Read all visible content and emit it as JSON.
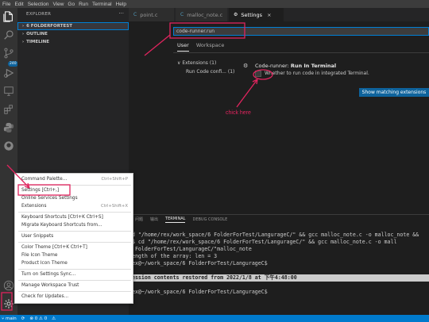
{
  "menubar": [
    "File",
    "Edit",
    "Selection",
    "View",
    "Go",
    "Run",
    "Terminal",
    "Help"
  ],
  "activity_icons": [
    "explorer-icon",
    "search-icon",
    "source-control-icon",
    "run-debug-icon",
    "remote-explorer-icon",
    "extensions-icon",
    "python-icon",
    "github-icon",
    "account-icon",
    "manage-gear-icon"
  ],
  "activity_badge": "240",
  "sidebar": {
    "title": "EXPLORER",
    "more": "···",
    "sections": [
      {
        "label": "6 FOLDERFORTEST",
        "active": true
      },
      {
        "label": "OUTLINE",
        "active": false
      },
      {
        "label": "TIMELINE",
        "active": false
      }
    ]
  },
  "tabs": [
    {
      "label": "point.c",
      "icon": "C",
      "active": false
    },
    {
      "label": "malloc_note.c",
      "icon": "C",
      "active": false
    },
    {
      "label": "Settings",
      "icon": "⚙",
      "active": true,
      "close": "×"
    }
  ],
  "settings": {
    "search_value": "code-runner.run",
    "scopes": [
      {
        "label": "User",
        "active": true
      },
      {
        "label": "Workspace",
        "active": false
      }
    ],
    "toc": [
      {
        "label": "Extensions (1)",
        "chev": "∨"
      },
      {
        "label": "Run Code confi... (1)",
        "chev": ""
      }
    ],
    "setting_prefix": "Code-runner: ",
    "setting_name": "Run In Terminal",
    "setting_desc": "Whether to run code in integrated Terminal.",
    "match_button": "Show matching extensions"
  },
  "annotation": {
    "text": "chick here",
    "color": "#e0245e"
  },
  "panel": {
    "tabs": [
      {
        "label": "问题",
        "active": false
      },
      {
        "label": "输出",
        "active": false
      },
      {
        "label": "TERMINAL",
        "active": true
      },
      {
        "label": "DEBUG CONSOLE",
        "active": false
      }
    ],
    "terminal_lines": [
      {
        "text": "cd \"/home/rex/work_space/6 FolderForTest/LangurageC/\" && gcc malloc_note.c -o malloc_note &&",
        "hl": false
      },
      {
        "text": "r$ cd \"/home/rex/work_space/6 FolderForTest/LangurageC/\" && gcc malloc_note.c -o mall",
        "hl": false
      },
      {
        "text": "6 FolderForTest/LangurageC/\"malloc_note",
        "hl": false
      },
      {
        "text": "length of the array: len = 3",
        "hl": false
      },
      {
        "text": "rex@~/work_space/6 FolderForTest/LangurageC$",
        "hl": false
      },
      {
        "text": "",
        "hl": false
      },
      {
        "text": "Session contents restored from 2022/1/8 at 下午4:48:00",
        "hl": true
      },
      {
        "text": "",
        "hl": false
      },
      {
        "text": "rex@~/work_space/6 FolderForTest/LangurageC$",
        "hl": false
      }
    ]
  },
  "context_menu": [
    {
      "label": "Command Palette...",
      "shortcut": "Ctrl+Shift+P",
      "sep_after": true
    },
    {
      "label": "Settings [Ctrl+,]",
      "shortcut": "",
      "sep_after": false
    },
    {
      "label": "Online Services Settings",
      "shortcut": "",
      "sep_after": false
    },
    {
      "label": "Extensions",
      "shortcut": "Ctrl+Shift+X",
      "sep_after": true
    },
    {
      "label": "Keyboard Shortcuts [Ctrl+K Ctrl+S]",
      "shortcut": "",
      "sep_after": false
    },
    {
      "label": "Migrate Keyboard Shortcuts from...",
      "shortcut": "",
      "sep_after": true
    },
    {
      "label": "User Snippets",
      "shortcut": "",
      "sep_after": true
    },
    {
      "label": "Color Theme [Ctrl+K Ctrl+T]",
      "shortcut": "",
      "sep_after": false
    },
    {
      "label": "File Icon Theme",
      "shortcut": "",
      "sep_after": false
    },
    {
      "label": "Product Icon Theme",
      "shortcut": "",
      "sep_after": true
    },
    {
      "label": "Turn on Settings Sync...",
      "shortcut": "",
      "sep_after": true
    },
    {
      "label": "Manage Workspace Trust",
      "shortcut": "",
      "sep_after": true
    },
    {
      "label": "Check for Updates...",
      "shortcut": "",
      "sep_after": false
    }
  ],
  "statusbar": [
    "⑂ main",
    "⟳",
    "⊗ 0 ⚠ 0",
    "⚠"
  ],
  "colors": {
    "accent": "#007acc",
    "annotation": "#e0245e",
    "activity_bar": "#333333",
    "sidebar": "#252526",
    "editor": "#1e1e1e",
    "button": "#0e639c"
  }
}
